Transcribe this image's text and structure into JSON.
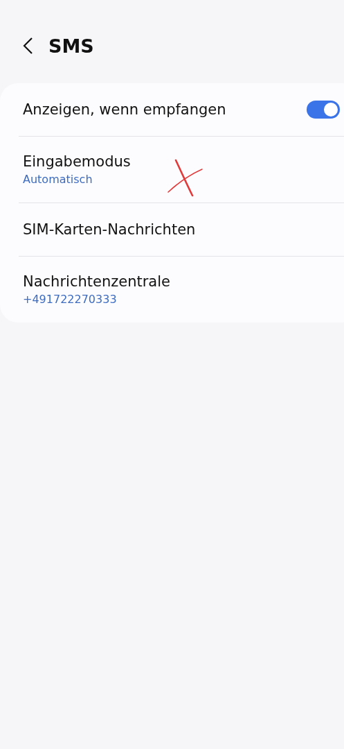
{
  "header": {
    "title": "SMS"
  },
  "settings": [
    {
      "kind": "toggle",
      "label": "Anzeigen, wenn empfangen",
      "on": true
    },
    {
      "kind": "subtitle",
      "label": "Eingabemodus",
      "value": "Automatisch"
    },
    {
      "kind": "plain",
      "label": "SIM-Karten-Nachrichten"
    },
    {
      "kind": "subtitle",
      "label": "Nachrichtenzentrale",
      "value": "+491722270333"
    }
  ]
}
